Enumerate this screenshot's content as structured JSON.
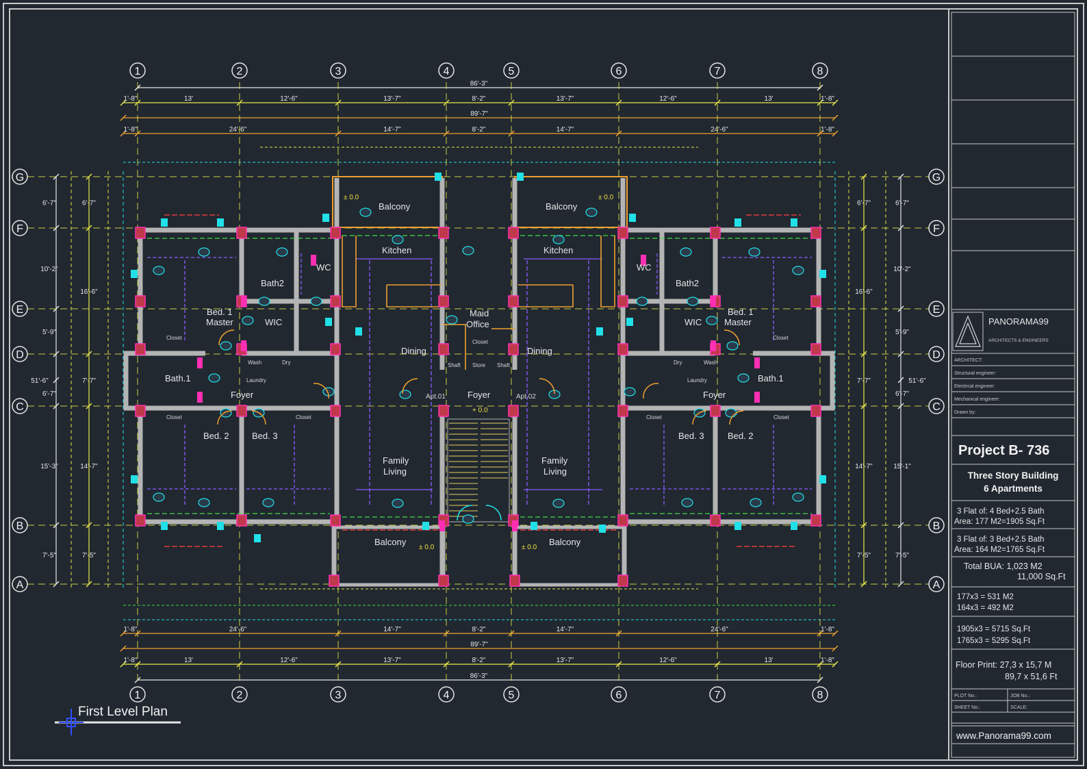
{
  "drawing_title": "First Level Plan",
  "grid_columns": [
    "1",
    "2",
    "3",
    "4",
    "5",
    "6",
    "7",
    "8"
  ],
  "grid_rows": [
    "A",
    "B",
    "C",
    "D",
    "E",
    "F",
    "G"
  ],
  "dims": {
    "overall": "86'-3\"",
    "overall_inner": "89'-7\"",
    "top_row1": [
      "1'-8\"",
      "13'",
      "12'-6\"",
      "13'-7\"",
      "8'-2\"",
      "13'-7\"",
      "12'-6\"",
      "13'",
      "1'-8\""
    ],
    "top_row2": [
      "1'-8\"",
      "24'-6\"",
      "14'-7\"",
      "8'-2\"",
      "14'-7\"",
      "24'-6\"",
      "1'-8\""
    ],
    "left_outer": [
      "6'-7\"",
      "10'-2\"",
      "5'-9\"",
      "51'-6\"",
      "6'-7\"",
      "15'-3\"",
      "7'-5\""
    ],
    "left_inner": [
      "6'-7\"",
      "16'-6\"",
      "7'-7\"",
      "14'-7\"",
      "7'-5\""
    ],
    "right_outer": [
      "6'-7\"",
      "10'-2\"",
      "5'-9\"",
      "51'-6\"",
      "6'-7\"",
      "15'-1\"",
      "7'-5\""
    ],
    "right_inner": [
      "6'-7\"",
      "16'-6\"",
      "7'-7\"",
      "14'-7\"",
      "7'-5\""
    ]
  },
  "rooms": {
    "balcony": "Balcony",
    "kitchen": "Kitchen",
    "wc": "WC",
    "bath2": "Bath2",
    "bed1": "Bed. 1",
    "master": "Master",
    "wic": "WIC",
    "dining": "Dining",
    "maid": "Maid",
    "office": "Office",
    "bath1": "Bath.1",
    "foyer": "Foyer",
    "laundry": "Laundry",
    "bed2": "Bed. 2",
    "bed3": "Bed. 3",
    "family": "Family",
    "living": "Living",
    "closet": "Closet",
    "wash": "Wash",
    "dry": "Dry",
    "store": "Store",
    "shaft": "Shaft",
    "apt01": "Apt.01",
    "apt02": "Apt.02",
    "level": "± 0.0",
    "stair_level": "+ 0.0"
  },
  "title_block": {
    "logo_name": "PANORAMA99",
    "logo_sub": "ARCHITECTS & ENGINEERS",
    "fields": [
      "ARCHITECT:",
      "Structural engineer:",
      "Electrical engineer:",
      "Mechanical engineer:",
      "Drawn by:"
    ],
    "project": "Project B- 736",
    "description": [
      "Three Story Building",
      "6 Apartments"
    ],
    "flat1": [
      "3 Flat of: 4 Bed+2.5 Bath",
      "Area: 177 M2=1905 Sq.Ft"
    ],
    "flat2": [
      "3 Flat of: 3 Bed+2.5 Bath",
      "Area: 164 M2=1765 Sq.Ft"
    ],
    "total": [
      "Total BUA: 1,023 M2",
      "11,000 Sq.Ft"
    ],
    "calc1": [
      "177x3 = 531 M2",
      "164x3 = 492 M2"
    ],
    "calc2": [
      "1905x3 = 5715 Sq.Ft",
      "1765x3 = 5295 Sq.Ft"
    ],
    "floor_print": [
      "Floor Print: 27,3 x 15,7 M",
      "89,7 x 51,6 Ft"
    ],
    "plot_no": "PLOT No.:",
    "job_no": "JOB No.:",
    "sheet_no": "SHEET No.:",
    "scale": "SCALE:",
    "website": "www.Panorama99.com"
  },
  "colors": {
    "background": "#212830",
    "border": "#c8c8c8",
    "grid": "#e8e84a",
    "dim_orange": "#f0a030",
    "wall": "#b4b4b4",
    "pink": "#ff2fb4",
    "cyan": "#22e0e8",
    "green": "#40e040",
    "purple": "#8a5cff",
    "red": "#e03a3a",
    "orange_door": "#ff8c00"
  }
}
